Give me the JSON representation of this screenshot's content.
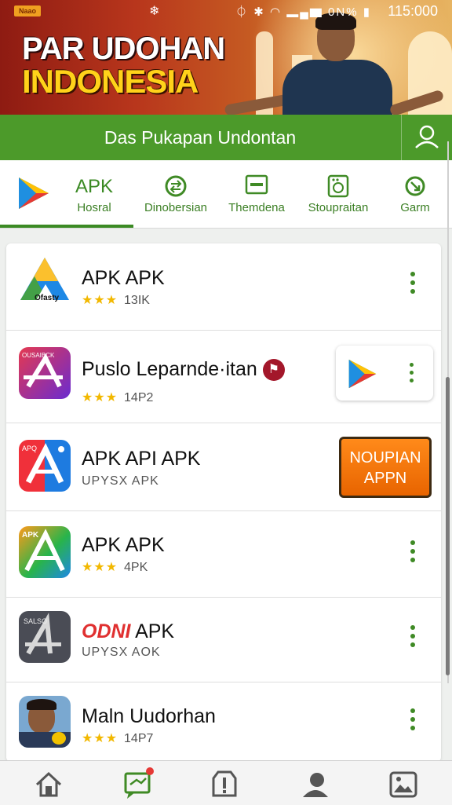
{
  "status_bar": {
    "tag": "Naao",
    "time": "115:000",
    "battery_label": "0N%"
  },
  "banner": {
    "line1": "PAR UDOHAN",
    "line2": "INDONESIA"
  },
  "header": {
    "title": "Das Pukapan Undontan"
  },
  "tabs": [
    {
      "big": "APK",
      "label": "Hosral",
      "icon": "play-store-icon"
    },
    {
      "label": "Dinobersian",
      "icon": "swap-circle-icon"
    },
    {
      "label": "Themdena",
      "icon": "minus-box-icon"
    },
    {
      "label": "Stoupraitan",
      "icon": "washer-icon"
    },
    {
      "label": "Garm",
      "icon": "clock-arrow-icon"
    }
  ],
  "apps": [
    {
      "name": "APK APK",
      "stars": "★★★",
      "meta": "13IK",
      "icon_label": "Ofasty"
    },
    {
      "name": "Puslo Leparnde·itan",
      "stars": "★★★",
      "meta": "14P2",
      "icon_label": "OUSAIBCK"
    },
    {
      "name": "APK API APK",
      "stars": "",
      "meta": "UPYSX APK",
      "icon_label": "APQ",
      "button": "NOUPIAN APPN"
    },
    {
      "name": "APK APK",
      "stars": "★★★",
      "meta": "4PK",
      "icon_label": "APK"
    },
    {
      "name_red": "ODNI",
      "name": "APK",
      "stars": "",
      "meta": "UPYSX AOK",
      "icon_label": "SALSO"
    },
    {
      "name": "Maln Uudorhan",
      "stars": "★★★",
      "meta": "14P7",
      "icon_label": ""
    }
  ],
  "bottom_nav": [
    "home-icon",
    "chat-icon",
    "alert-icon",
    "profile-icon",
    "gallery-icon"
  ],
  "colors": {
    "primary_green": "#4c9a2a",
    "accent_orange": "#ff7a10",
    "star": "#f2b800"
  }
}
